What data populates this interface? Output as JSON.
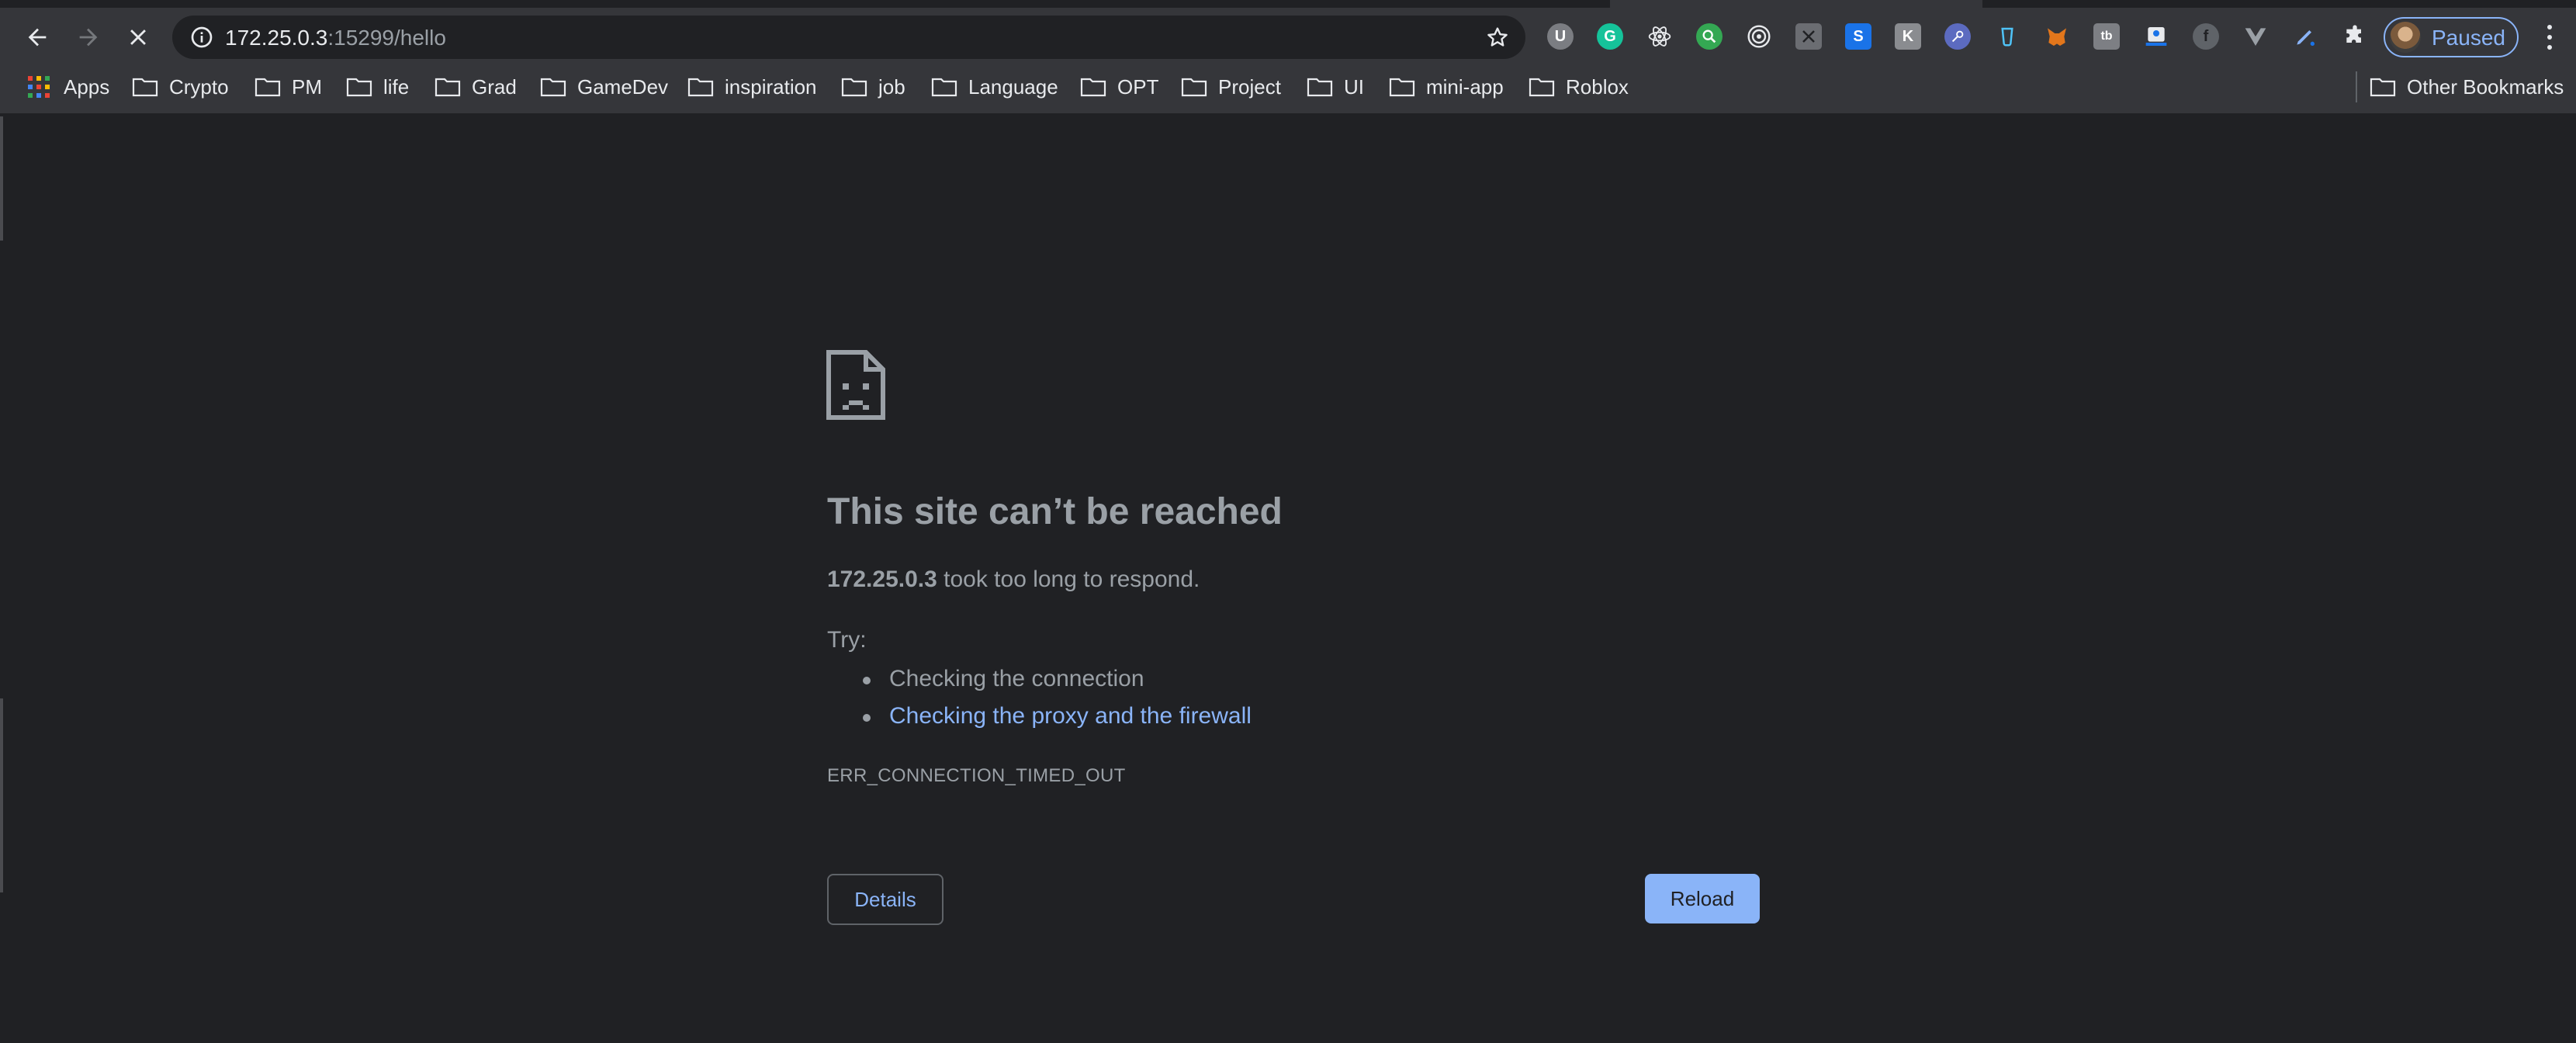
{
  "browser": {
    "url_host": "172.25.0.3",
    "url_rest": ":15299/hello",
    "profile_label": "Paused",
    "accent": "#8ab4f8"
  },
  "bookmarks": {
    "apps_label": "Apps",
    "folders": [
      "Crypto",
      "PM",
      "life",
      "Grad",
      "GameDev",
      "inspiration",
      "job",
      "Language",
      "OPT",
      "Project",
      "UI",
      "mini-app",
      "Roblox"
    ],
    "other_label": "Other Bookmarks"
  },
  "extensions": [
    "ublock-icon",
    "grammarly-icon",
    "react-devtools-icon",
    "search-extension-icon",
    "target-extension-icon",
    "scissors-extension-icon",
    "s-extension-icon",
    "k-extension-icon",
    "key-extension-icon",
    "cup-extension-icon",
    "metamask-icon",
    "tb-extension-icon",
    "notebook-extension-icon",
    "facebook-icon",
    "vue-devtools-icon",
    "pen-extension-icon",
    "puzzle-extensions-icon"
  ],
  "error": {
    "title": "This site can’t be reached",
    "host": "172.25.0.3",
    "message": " took too long to respond.",
    "try_label": "Try:",
    "suggestions": [
      "Checking the connection",
      "Checking the proxy and the firewall"
    ],
    "code": "ERR_CONNECTION_TIMED_OUT",
    "details_label": "Details",
    "reload_label": "Reload"
  }
}
